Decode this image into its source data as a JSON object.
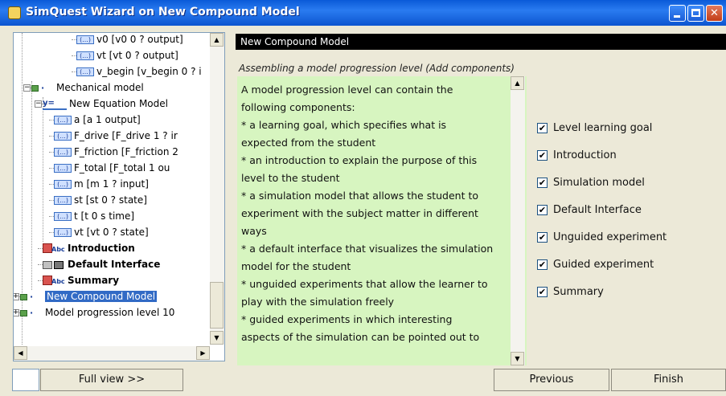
{
  "window": {
    "title": "SimQuest Wizard on New Compound Model"
  },
  "tree": {
    "nodes": [
      {
        "label": "v0 [v0 0 ? output]",
        "icon": "variable-icon",
        "selected": false
      },
      {
        "label": "vt [vt 0 ? output]",
        "icon": "variable-icon",
        "selected": false
      },
      {
        "label": "v_begin [v_begin 0 ? i",
        "icon": "variable-icon",
        "selected": false
      },
      {
        "label": "Mechanical model",
        "icon": "model-icon",
        "selected": false
      },
      {
        "label": "New Equation Model",
        "icon": "equation-icon",
        "selected": false
      },
      {
        "label": "a [a 1  output]",
        "icon": "variable-icon",
        "selected": false
      },
      {
        "label": "F_drive [F_drive 1 ? ir",
        "icon": "variable-icon",
        "selected": false
      },
      {
        "label": "F_friction [F_friction 2",
        "icon": "variable-icon",
        "selected": false
      },
      {
        "label": "F_total [F_total 1  ou",
        "icon": "variable-icon",
        "selected": false
      },
      {
        "label": "m [m 1 ? input]",
        "icon": "variable-icon",
        "selected": false
      },
      {
        "label": "st [st 0 ? state]",
        "icon": "variable-icon",
        "selected": false
      },
      {
        "label": "t [t 0 s time]",
        "icon": "variable-icon",
        "selected": false
      },
      {
        "label": "vt [vt 0 ? state]",
        "icon": "variable-icon",
        "selected": false
      },
      {
        "label": "Introduction",
        "icon": "text-abc-icon",
        "selected": false
      },
      {
        "label": "Default Interface",
        "icon": "interface-icon",
        "selected": false
      },
      {
        "label": "Summary",
        "icon": "text-abc-icon",
        "selected": false
      },
      {
        "label": "New Compound Model",
        "icon": "model-icon",
        "selected": true
      },
      {
        "label": "Model progression level 10",
        "icon": "model-icon",
        "selected": false
      }
    ],
    "variable_icon_text": "(...)"
  },
  "header": {
    "title": "New Compound Model"
  },
  "subtitle": "Assembling a model progression level (Add components)",
  "description": {
    "lines": [
      "A model progression level can contain the",
      "following components:",
      "* a learning goal, which specifies what is",
      "expected from the student",
      "* an introduction to explain the purpose of this",
      "level to the student",
      "* a simulation model that allows the student to",
      "experiment with the subject matter in different",
      "ways",
      "* a default interface that visualizes the simulation",
      "model for the student",
      "* unguided experiments that allow the learner to",
      "play with the simulation freely",
      "* guided experiments in which interesting",
      "aspects of the simulation can be pointed out to"
    ]
  },
  "components": [
    {
      "label": "Level learning goal",
      "checked": true
    },
    {
      "label": "Introduction",
      "checked": true
    },
    {
      "label": "Simulation model",
      "checked": true
    },
    {
      "label": "Default Interface",
      "checked": true
    },
    {
      "label": "Unguided experiment",
      "checked": true
    },
    {
      "label": "Guided experiment",
      "checked": true
    },
    {
      "label": "Summary",
      "checked": true
    }
  ],
  "buttons": {
    "full_view": "Full view >>",
    "previous": "Previous",
    "finish": "Finish"
  },
  "glyphs": {
    "check": "✔",
    "up": "▲",
    "down": "▼",
    "left": "◀",
    "right": "▶",
    "minus": "−",
    "plus": "+",
    "close": "✕",
    "eq": "y=",
    "abc": "Abc",
    "mid_dot": "·"
  }
}
